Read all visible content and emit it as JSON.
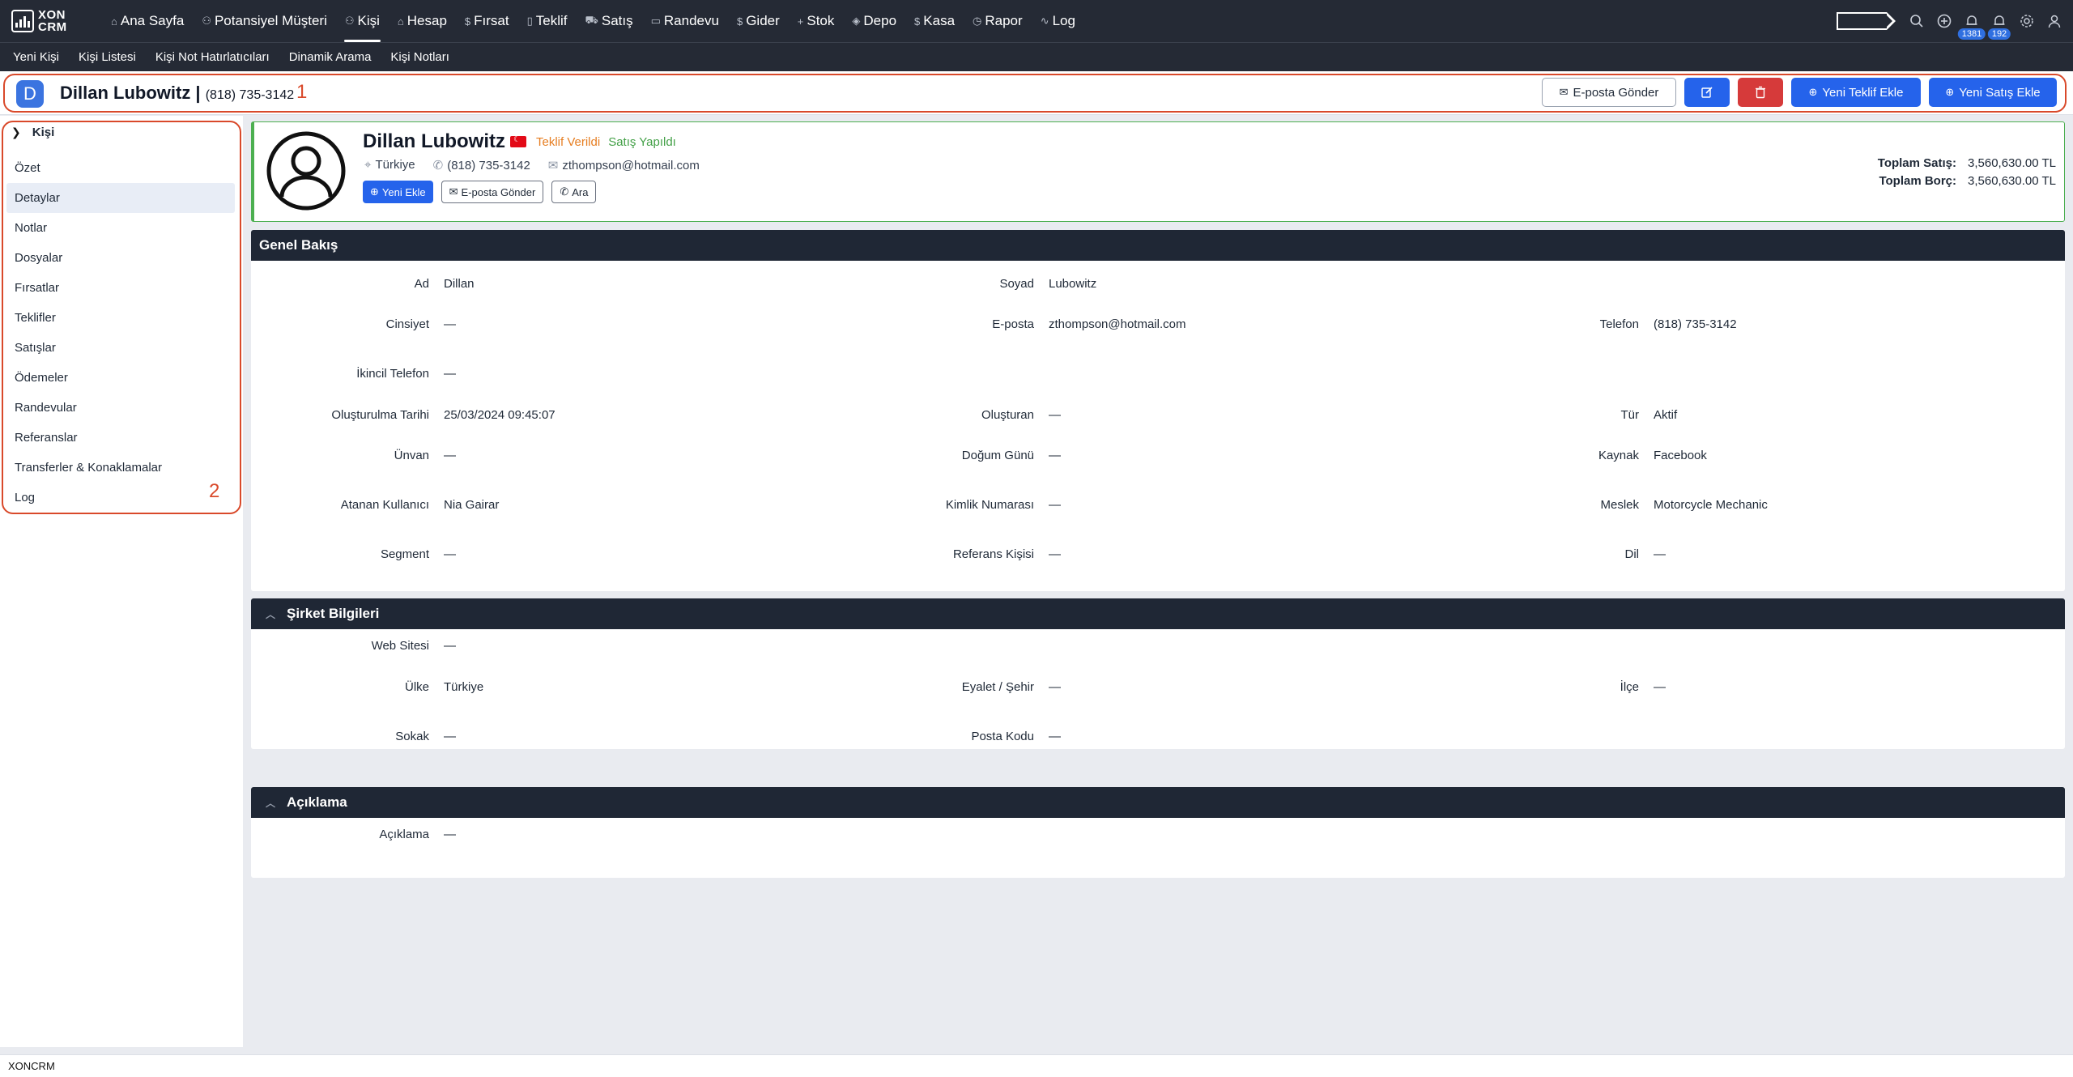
{
  "app": {
    "logo_line1": "XON",
    "logo_line2": "CRM",
    "footer": "XONCRM"
  },
  "nav": {
    "items": [
      {
        "label": "Ana Sayfa",
        "icon": "home-icon",
        "glyph": "⌂"
      },
      {
        "label": "Potansiyel Müşteri",
        "icon": "users-icon",
        "glyph": "⚇"
      },
      {
        "label": "Kişi",
        "icon": "person-icon",
        "glyph": "⚇",
        "active": true
      },
      {
        "label": "Hesap",
        "icon": "building-icon",
        "glyph": "⌂"
      },
      {
        "label": "Fırsat",
        "icon": "dollar-icon",
        "glyph": "$"
      },
      {
        "label": "Teklif",
        "icon": "document-icon",
        "glyph": "▯"
      },
      {
        "label": "Satış",
        "icon": "cart-icon",
        "glyph": "⛟"
      },
      {
        "label": "Randevu",
        "icon": "calendar-icon",
        "glyph": "▭"
      },
      {
        "label": "Gider",
        "icon": "dollar-icon",
        "glyph": "$"
      },
      {
        "label": "Stok",
        "icon": "plus-icon",
        "glyph": "+"
      },
      {
        "label": "Depo",
        "icon": "box-icon",
        "glyph": "◈"
      },
      {
        "label": "Kasa",
        "icon": "dollar-icon",
        "glyph": "$"
      },
      {
        "label": "Rapor",
        "icon": "clock-icon",
        "glyph": "◷"
      },
      {
        "label": "Log",
        "icon": "activity-icon",
        "glyph": "∿"
      }
    ],
    "badges": {
      "notif1": "1381",
      "notif2": "192"
    }
  },
  "subnav": {
    "items": [
      "Yeni Kişi",
      "Kişi Listesi",
      "Kişi Not Hatırlatıcıları",
      "Dinamik Arama",
      "Kişi Notları"
    ]
  },
  "header": {
    "avatar_letter": "D",
    "name": "Dillan Lubowitz |",
    "phone": "(818) 735-3142",
    "annotation": "1",
    "email_button": "E-posta Gönder",
    "new_offer_button": "Yeni Teklif Ekle",
    "new_sale_button": "Yeni Satış Ekle"
  },
  "sidebar": {
    "title": "Kişi",
    "annotation": "2",
    "items": [
      "Özet",
      "Detaylar",
      "Notlar",
      "Dosyalar",
      "Fırsatlar",
      "Teklifler",
      "Satışlar",
      "Ödemeler",
      "Randevular",
      "Referanslar",
      "Transferler & Konaklamalar",
      "Log"
    ],
    "active_index": 1
  },
  "profile": {
    "name": "Dillan Lubowitz",
    "status_offer": "Teklif Verildi",
    "status_sale": "Satış Yapıldı",
    "country": "Türkiye",
    "phone": "(818) 735-3142",
    "email": "zthompson@hotmail.com",
    "btn_new": "Yeni Ekle",
    "btn_email": "E-posta Gönder",
    "btn_call": "Ara",
    "total_sales_label": "Toplam Satış:",
    "total_sales_value": "3,560,630.00 TL",
    "total_debt_label": "Toplam Borç:",
    "total_debt_value": "3,560,630.00 TL"
  },
  "overview": {
    "title": "Genel Bakış",
    "fields": {
      "ad": {
        "label": "Ad",
        "value": "Dillan"
      },
      "soyad": {
        "label": "Soyad",
        "value": "Lubowitz"
      },
      "cinsiyet": {
        "label": "Cinsiyet",
        "value": "—"
      },
      "eposta": {
        "label": "E-posta",
        "value": "zthompson@hotmail.com"
      },
      "telefon": {
        "label": "Telefon",
        "value": "(818) 735-3142"
      },
      "ikincil": {
        "label": "İkincil Telefon",
        "value": "—"
      },
      "olusturulma": {
        "label": "Oluşturulma Tarihi",
        "value": "25/03/2024 09:45:07"
      },
      "olusturan": {
        "label": "Oluşturan",
        "value": "—"
      },
      "tur": {
        "label": "Tür",
        "value": "Aktif"
      },
      "unvan": {
        "label": "Ünvan",
        "value": "—"
      },
      "dogum": {
        "label": "Doğum Günü",
        "value": "—"
      },
      "kaynak": {
        "label": "Kaynak",
        "value": "Facebook"
      },
      "atanan": {
        "label": "Atanan Kullanıcı",
        "value": "Nia Gairar"
      },
      "kimlik": {
        "label": "Kimlik Numarası",
        "value": "—"
      },
      "meslek": {
        "label": "Meslek",
        "value": "Motorcycle Mechanic"
      },
      "segment": {
        "label": "Segment",
        "value": "—"
      },
      "referans": {
        "label": "Referans Kişisi",
        "value": "—"
      },
      "dil": {
        "label": "Dil",
        "value": "—"
      }
    }
  },
  "company": {
    "title": "Şirket Bilgileri",
    "fields": {
      "web": {
        "label": "Web Sitesi",
        "value": "—"
      },
      "ulke": {
        "label": "Ülke",
        "value": "Türkiye"
      },
      "eyalet": {
        "label": "Eyalet / Şehir",
        "value": "—"
      },
      "ilce": {
        "label": "İlçe",
        "value": "—"
      },
      "sokak": {
        "label": "Sokak",
        "value": "—"
      },
      "posta": {
        "label": "Posta Kodu",
        "value": "—"
      }
    }
  },
  "description": {
    "title": "Açıklama",
    "fields": {
      "aciklama": {
        "label": "Açıklama",
        "value": "—"
      }
    }
  }
}
